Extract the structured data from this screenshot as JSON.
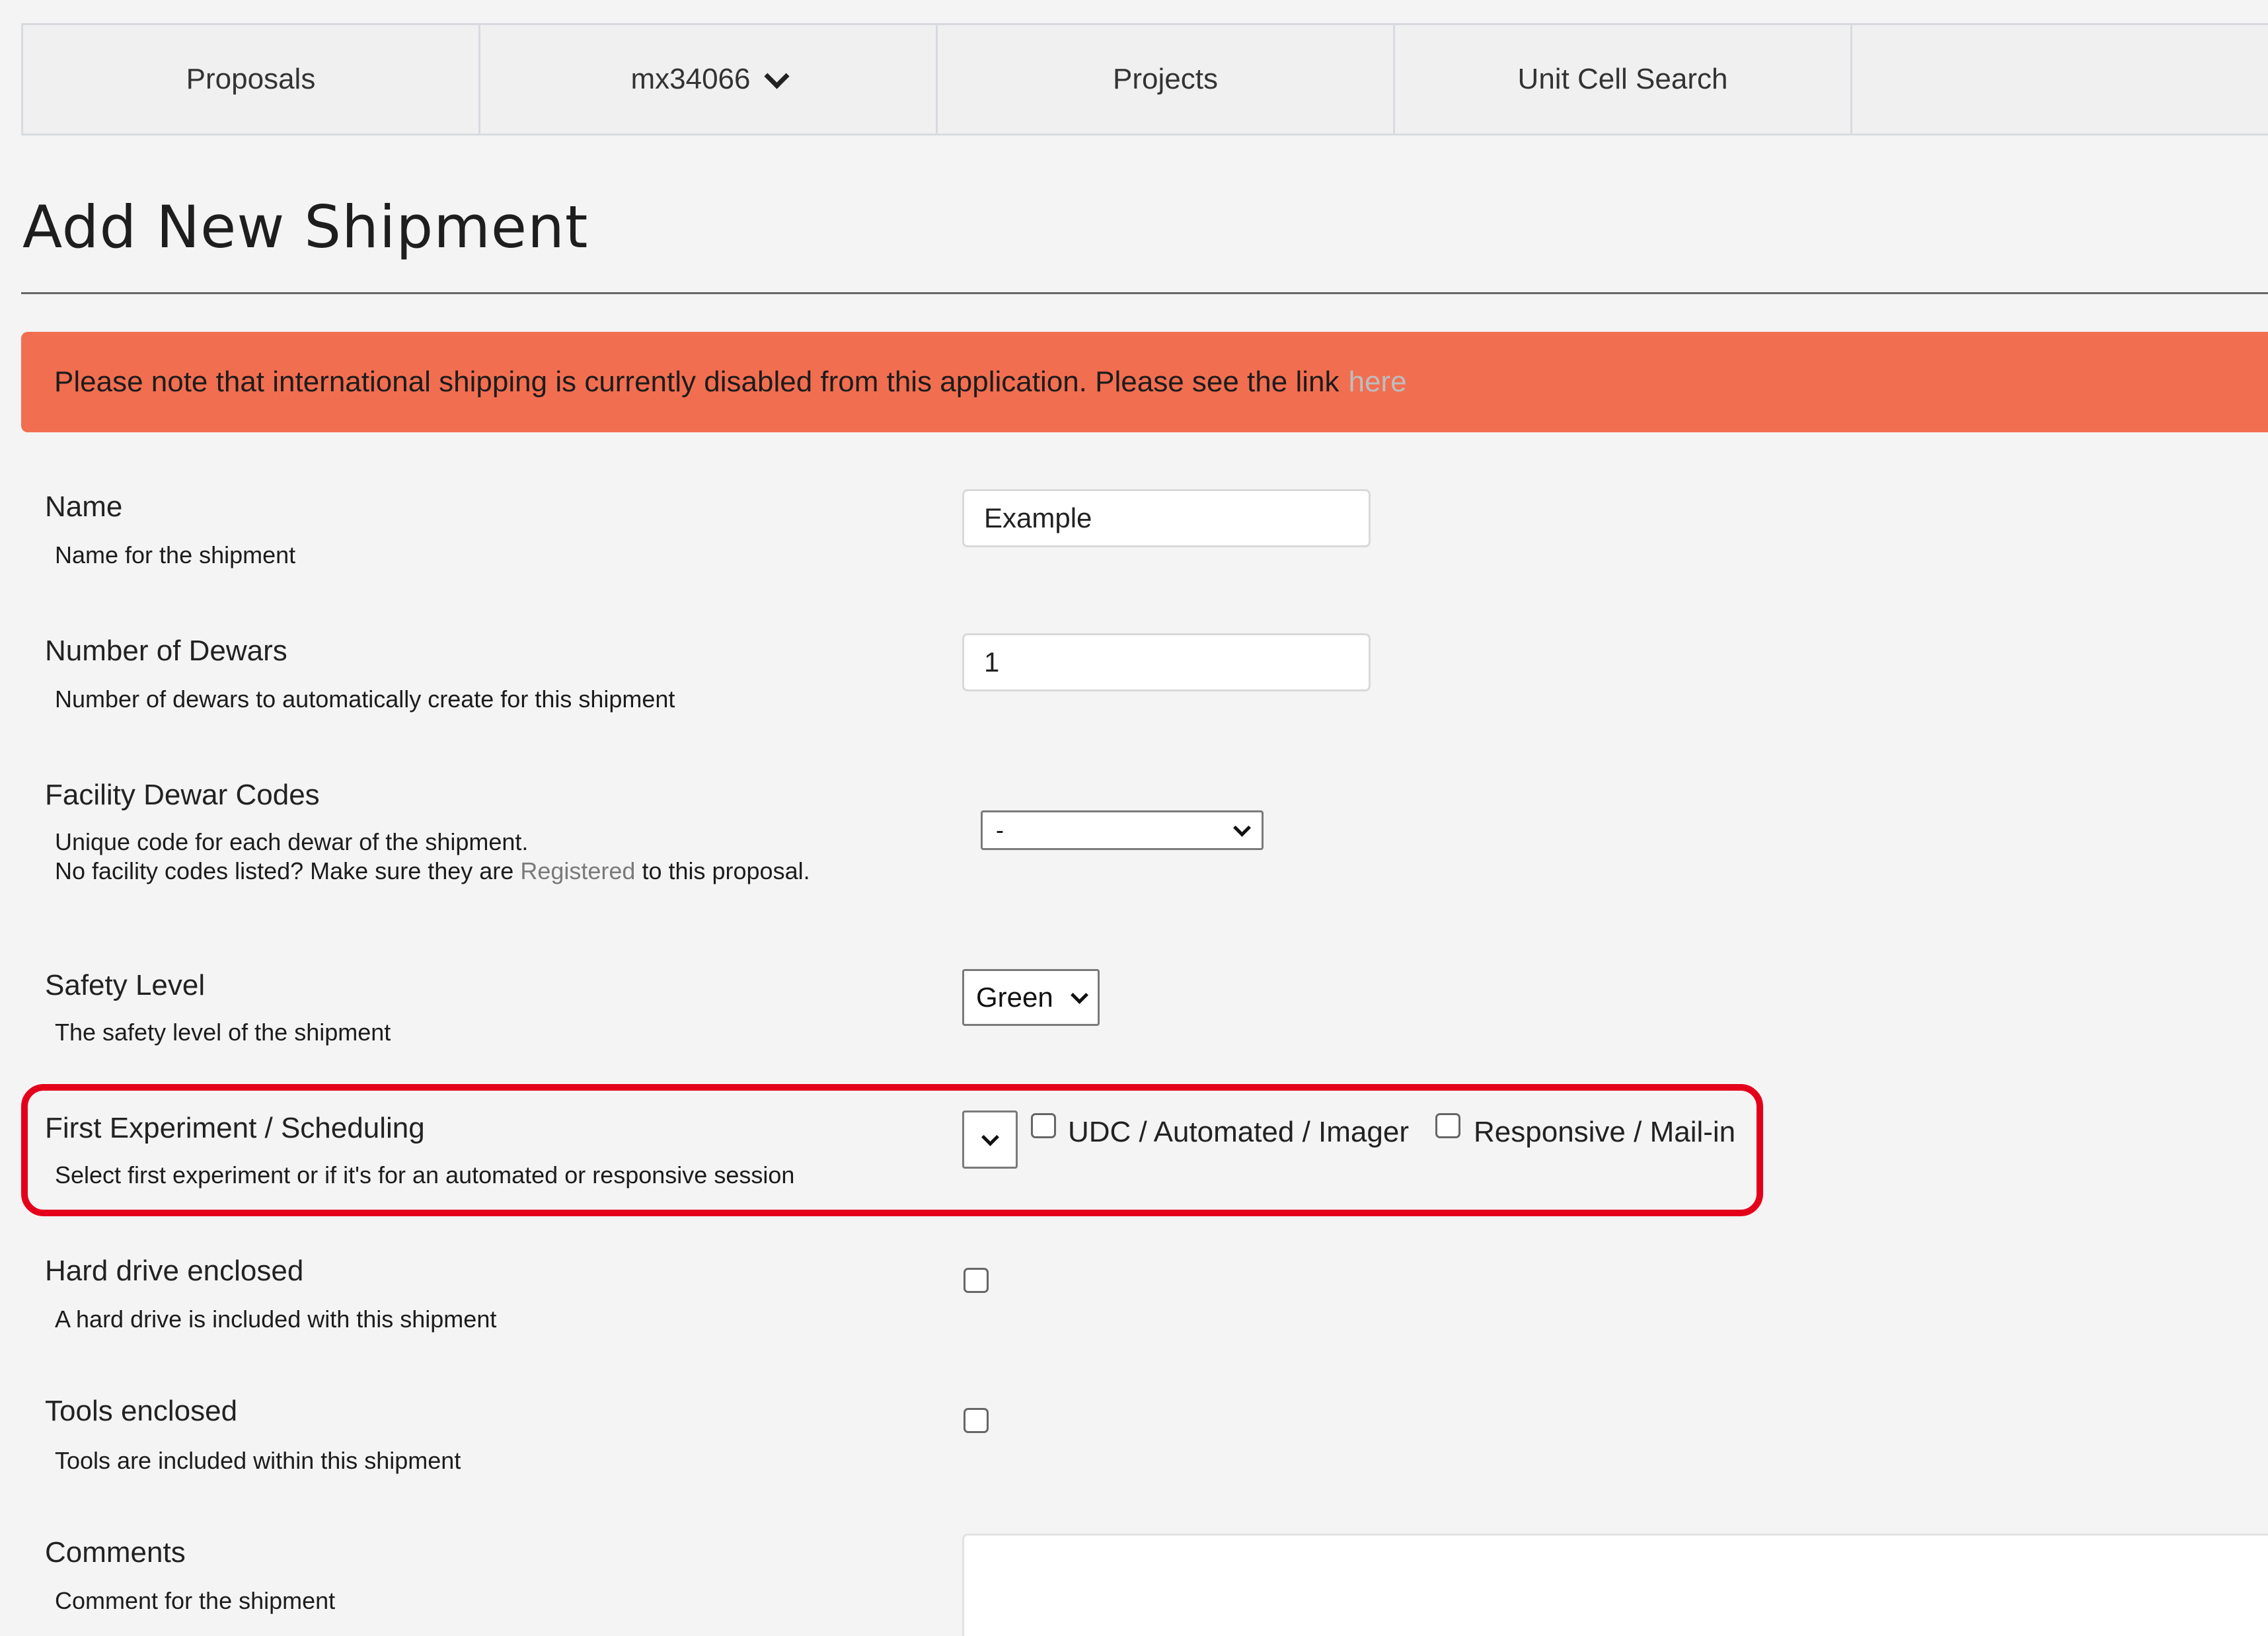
{
  "nav": {
    "items": [
      {
        "label": "Proposals"
      },
      {
        "label": "mx34066"
      },
      {
        "label": "Projects"
      },
      {
        "label": "Unit Cell Search"
      }
    ]
  },
  "page": {
    "title": "Add New Shipment"
  },
  "alert": {
    "text": "Please note that international shipping is currently disabled from this application. Please see the link",
    "link_text": "here"
  },
  "form": {
    "name": {
      "label": "Name",
      "description": "Name for the shipment",
      "value": "Example"
    },
    "dewars": {
      "label": "Number of Dewars",
      "description": "Number of dewars to automatically create for this shipment",
      "value": "1"
    },
    "facility_codes": {
      "label": "Facility Dewar Codes",
      "description_line1": "Unique code for each dewar of the shipment.",
      "description_line2_pre": "No facility codes listed? Make sure they are",
      "description_link": "Registered",
      "description_line2_post": "to this proposal.",
      "selected": "-"
    },
    "safety": {
      "label": "Safety Level",
      "description": "The safety level of the shipment",
      "selected": "Green"
    },
    "first_experiment": {
      "label": "First Experiment / Scheduling",
      "description": "Select first experiment or if it's for an automated or responsive session",
      "selected": "",
      "option_udc": "UDC / Automated / Imager",
      "option_responsive": "Responsive / Mail-in"
    },
    "hard_drive": {
      "label": "Hard drive enclosed",
      "description": "A hard drive is included with this shipment",
      "checked": false
    },
    "tools": {
      "label": "Tools enclosed",
      "description": "Tools are included within this shipment",
      "checked": false
    },
    "comments": {
      "label": "Comments",
      "description": "Comment for the shipment",
      "value": ""
    }
  },
  "colors": {
    "alert_bg": "#f26e50",
    "highlight_border": "#e4001b",
    "page_bg": "#f4f4f4"
  }
}
